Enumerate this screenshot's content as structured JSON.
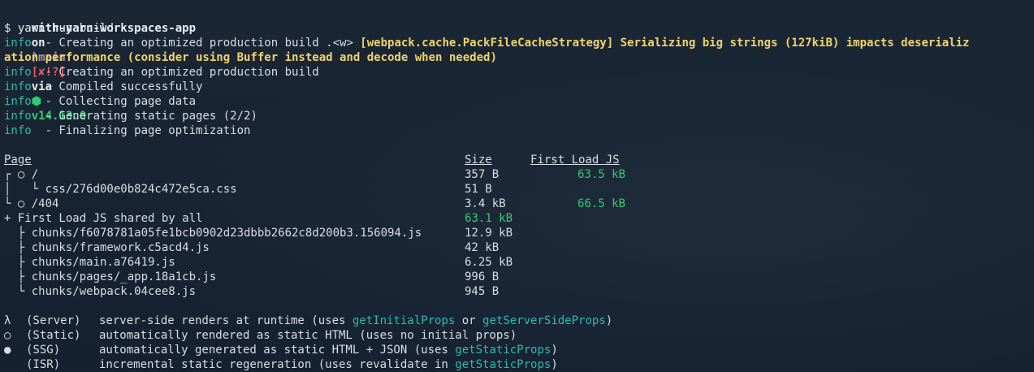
{
  "prompt": {
    "project": "with-yarn-workspaces-app",
    "on": "on",
    "branch_icon": "git-branch-icon",
    "branch_glyph": "ᚹ",
    "branch": "main",
    "status": "[✘!?]",
    "via": "via",
    "node_glyph": "⬢",
    "node_version": "v14.13.0"
  },
  "command": {
    "dollar": "$",
    "text": "yarn run build"
  },
  "log": [
    {
      "tag": "info",
      "text": "  - Creating an optimized production build .<w> ",
      "warn": "[webpack.cache.PackFileCacheStrategy] Serializing big strings (127kiB) impacts deserializ"
    },
    {
      "tag": "",
      "text": "",
      "warn": "ation performance (consider using Buffer instead and decode when needed)"
    },
    {
      "tag": "info",
      "text": "  - Creating an optimized production build",
      "warn": ""
    },
    {
      "tag": "info",
      "text": "  - Compiled successfully",
      "warn": ""
    },
    {
      "tag": "info",
      "text": "  - Collecting page data",
      "warn": ""
    },
    {
      "tag": "info",
      "text": "  - Generating static pages (2/2)",
      "warn": ""
    },
    {
      "tag": "info",
      "text": "  - Finalizing page optimization",
      "warn": ""
    }
  ],
  "table": {
    "headers": {
      "page": "Page",
      "size": "Size",
      "first_load": "First Load JS"
    },
    "rows": [
      {
        "path": "┌ ○ /",
        "size": "357 B",
        "first": "63.5 kB",
        "first_color": "green"
      },
      {
        "path": "│   └ css/276d00e0b824c472e5ca.css",
        "size": "51 B",
        "first": "",
        "first_color": ""
      },
      {
        "path": "└ ○ /404",
        "size": "3.4 kB",
        "first": "66.5 kB",
        "first_color": "green"
      },
      {
        "path": "+ First Load JS shared by all",
        "size": "63.1 kB",
        "first": "",
        "first_color": "",
        "size_color": "green"
      },
      {
        "path": "  ├ chunks/f6078781a05fe1bcb0902d23dbbb2662c8d200b3.156094.js",
        "size": "12.9 kB",
        "first": "",
        "first_color": ""
      },
      {
        "path": "  ├ chunks/framework.c5acd4.js",
        "size": "42 kB",
        "first": "",
        "first_color": ""
      },
      {
        "path": "  ├ chunks/main.a76419.js",
        "size": "6.25 kB",
        "first": "",
        "first_color": ""
      },
      {
        "path": "  ├ chunks/pages/_app.18a1cb.js",
        "size": "996 B",
        "first": "",
        "first_color": ""
      },
      {
        "path": "  └ chunks/webpack.04cee8.js",
        "size": "945 B",
        "first": "",
        "first_color": ""
      }
    ]
  },
  "legend": [
    {
      "sym": "λ",
      "kind": "(Server)",
      "desc": "server-side renders at runtime (uses ",
      "hl1": "getInitialProps",
      "mid": " or ",
      "hl2": "getServerSideProps",
      "end": ")"
    },
    {
      "sym": "○",
      "kind": "(Static)",
      "desc": "automatically rendered as static HTML (uses no initial props)",
      "hl1": "",
      "mid": "",
      "hl2": "",
      "end": ""
    },
    {
      "sym": "●",
      "kind": "(SSG)",
      "desc": "automatically generated as static HTML + JSON (uses ",
      "hl1": "getStaticProps",
      "mid": "",
      "hl2": "",
      "end": ")"
    },
    {
      "sym": " ",
      "kind": "(ISR)",
      "desc": "incremental static regeneration (uses revalidate in ",
      "hl1": "getStaticProps",
      "mid": "",
      "hl2": "",
      "end": ")"
    }
  ],
  "colors": {
    "background": "#162230",
    "green": "#2ecc71",
    "cyan": "#2bbbad",
    "yellow": "#f0d36a",
    "red": "#e0565a",
    "purple": "#b48ead"
  }
}
